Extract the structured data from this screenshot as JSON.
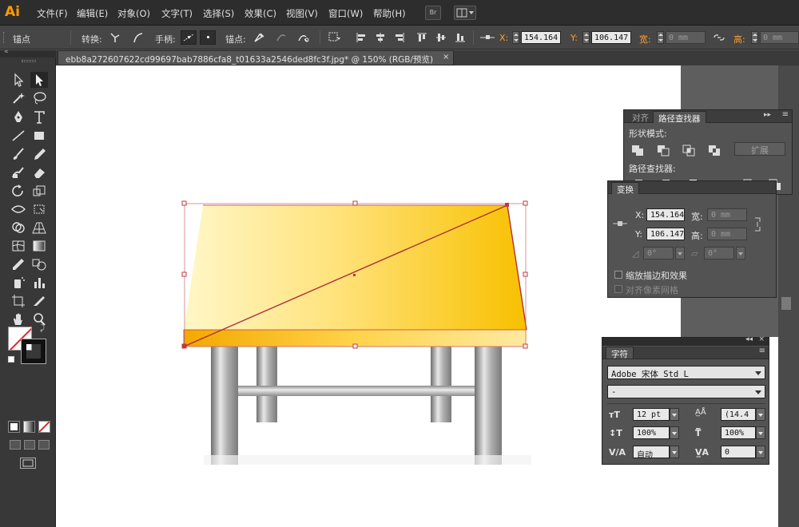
{
  "app": {
    "logo": "Ai"
  },
  "menu": [
    {
      "label": "文件(F)"
    },
    {
      "label": "编辑(E)"
    },
    {
      "label": "对象(O)"
    },
    {
      "label": "文字(T)"
    },
    {
      "label": "选择(S)"
    },
    {
      "label": "效果(C)"
    },
    {
      "label": "视图(V)"
    },
    {
      "label": "窗口(W)"
    },
    {
      "label": "帮助(H)"
    }
  ],
  "menubar_buttons": {
    "bridge": "Br",
    "arrange_icon": "workspace-arrange-icon"
  },
  "control": {
    "mode_label": "锚点",
    "convert_label": "转换:",
    "handle_label": "手柄:",
    "anchor_label": "锚点:",
    "x_label": "X:",
    "x_value": "154.164",
    "y_label": "Y:",
    "y_value": "106.147",
    "w_label": "宽:",
    "w_value": "0 mm",
    "h_label": "高:",
    "h_value": "0 mm"
  },
  "document": {
    "tab_title": "ebb8a272607622cd99697bab7886cfa8_t01633a2546ded8fc3f.jpg* @ 150% (RGB/预览)",
    "close": "×"
  },
  "pathfinder_panel": {
    "tabs": [
      "对齐",
      "路径查找器"
    ],
    "active_tab": "路径查找器",
    "shape_modes_label": "形状模式:",
    "expand_label": "扩展",
    "pathfinders_label": "路径查找器:"
  },
  "transform_panel": {
    "title": "变换",
    "x_label": "X:",
    "x_value": "154.164",
    "y_label": "Y:",
    "y_value": "106.147",
    "w_label": "宽:",
    "w_value": "0 mm",
    "h_label": "高:",
    "h_value": "0 mm",
    "rotate_value": "0°",
    "shear_value": "0°",
    "scale_strokes_label": "缩放描边和效果",
    "align_pixel_label": "对齐像素网格"
  },
  "character_panel": {
    "title": "字符",
    "font_family": "Adobe 宋体 Std L",
    "font_style": "-",
    "font_size": "12 pt",
    "leading": "(14.4",
    "vscale": "100%",
    "hscale": "100%",
    "kerning": "自动",
    "tracking": "0"
  },
  "colors": {
    "accent": "#ff9a00",
    "tabletop_light": "#fff7c8",
    "tabletop_dark": "#f8c000",
    "selection": "#c0393b",
    "leg_metal": "#9a9a9a"
  }
}
